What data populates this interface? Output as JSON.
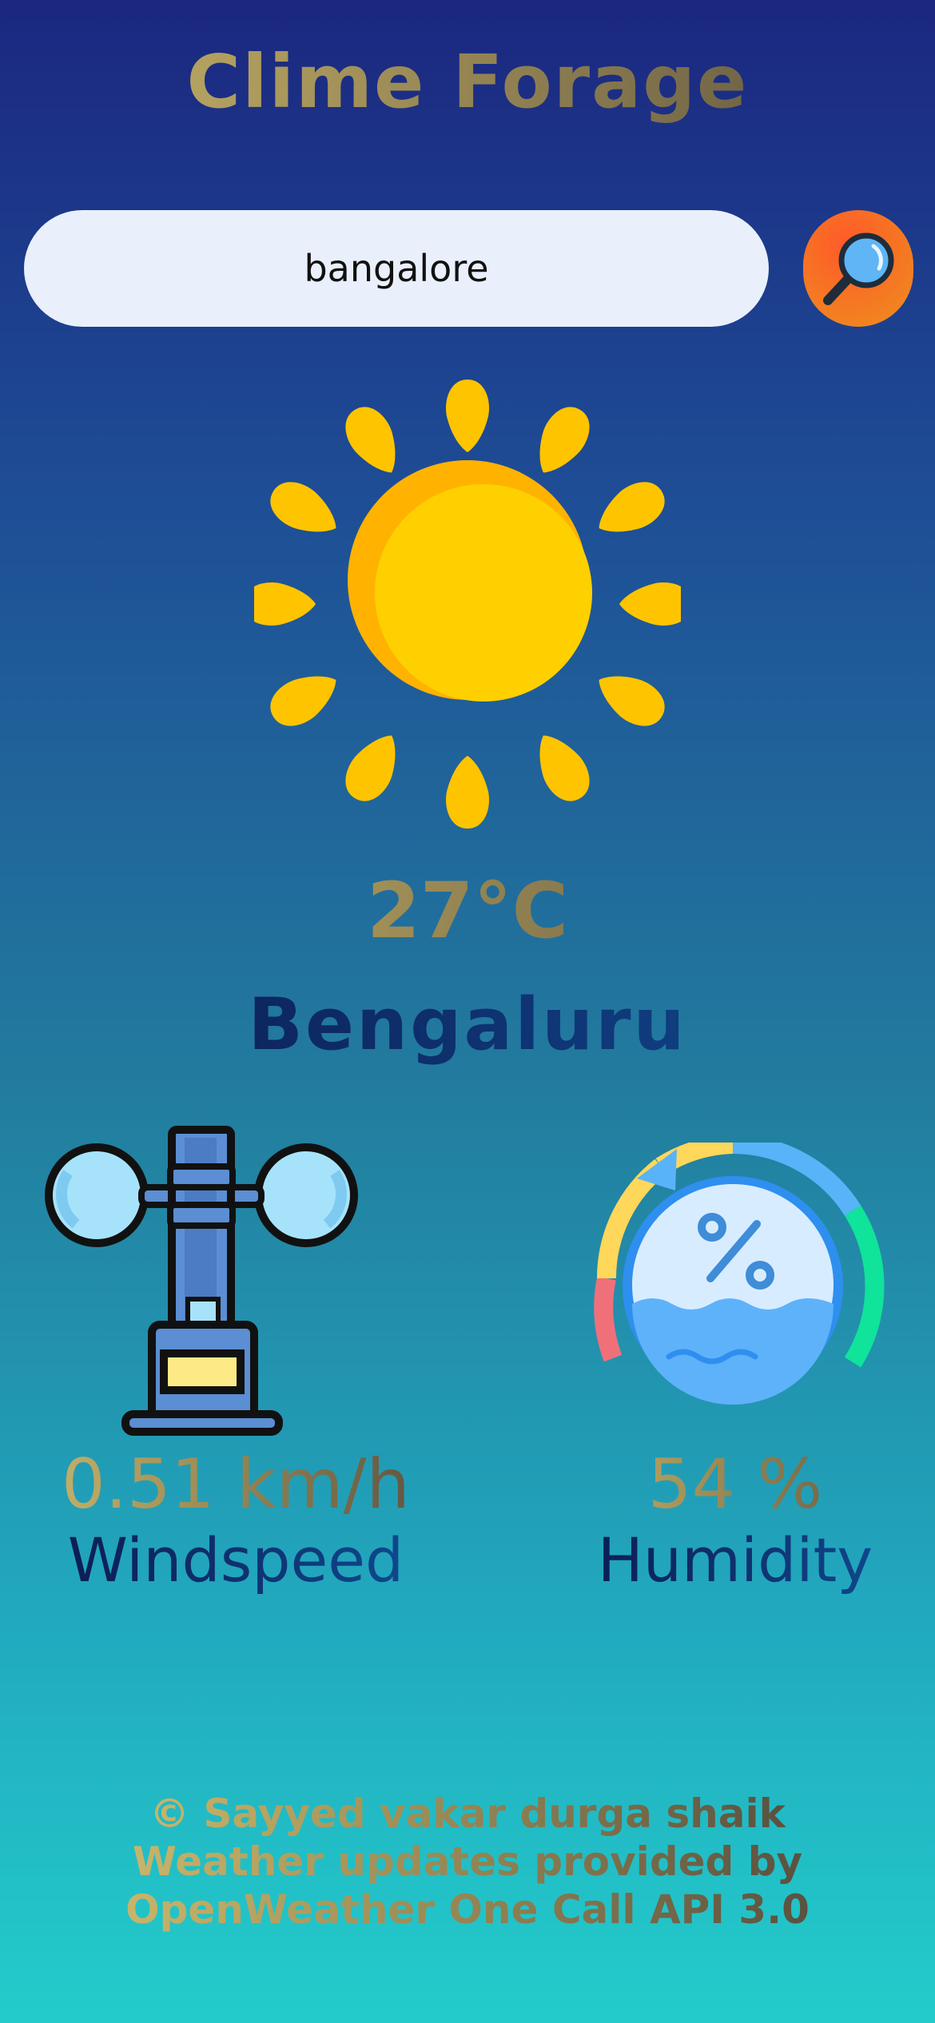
{
  "app": {
    "title": "Clime Forage"
  },
  "search": {
    "value": "bangalore",
    "button_icon": "search-icon"
  },
  "weather": {
    "condition_icon": "sun-icon",
    "temperature": "27°C",
    "city": "Bengaluru"
  },
  "stats": {
    "wind": {
      "icon": "anemometer-icon",
      "value": "0.51 km/h",
      "label": "Windspeed"
    },
    "humidity": {
      "icon": "humidity-gauge-icon",
      "value": "54 %",
      "label": "Humidity"
    }
  },
  "footer": {
    "line1": "© Sayyed vakar durga shaik",
    "line2": "Weather updates provided by",
    "line3": "OpenWeather One Call API 3.0"
  },
  "colors": {
    "background_top": "#1b2780",
    "background_bottom": "#23cccb",
    "sun": "#ffc400",
    "search_button": "#f47a22",
    "title_gold": "#c8b56a"
  }
}
